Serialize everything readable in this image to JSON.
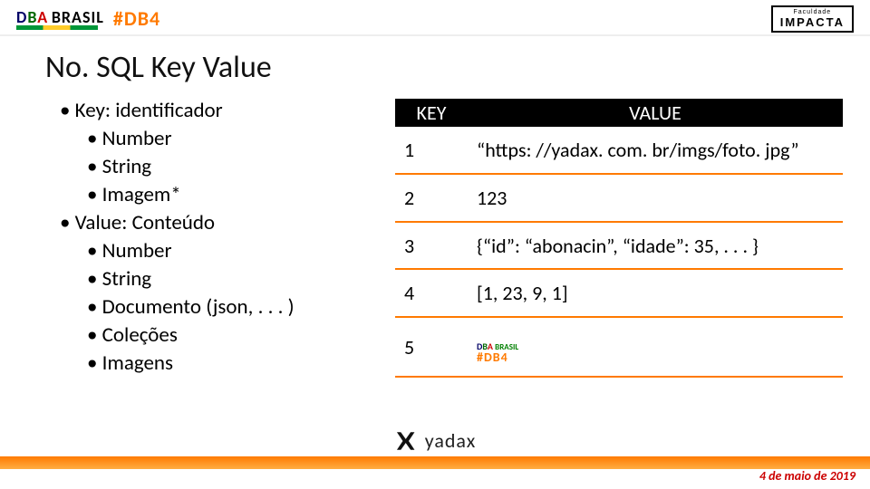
{
  "header": {
    "dba": "DBA",
    "brasil": "BRASIL",
    "db4": "#DB4",
    "impacta_top": "Faculdade",
    "impacta_name": "IMPACTA"
  },
  "title": "No. SQL Key Value",
  "bullets": {
    "l0": "Key: identificador",
    "l1": "Number",
    "l2": "String",
    "l3": "Imagem*",
    "l4": "Value: Conteúdo",
    "l5": "Number",
    "l6": "String",
    "l7": "Documento (json, . . . )",
    "l8": "Coleções",
    "l9": "Imagens"
  },
  "table": {
    "head_key": "KEY",
    "head_val": "VALUE",
    "rows": [
      {
        "k": "1",
        "v": "“https: //yadax. com. br/imgs/foto. jpg”"
      },
      {
        "k": "2",
        "v": "123"
      },
      {
        "k": "3",
        "v": "{“id”: “abonacin”, “idade”: 35, . . . }"
      },
      {
        "k": "4",
        "v": "[1, 23, 9, 1]"
      },
      {
        "k": "5",
        "v": ""
      }
    ],
    "logo_row_index": 4,
    "mini_dba": "DBA",
    "mini_brasil": "BRASIL",
    "mini_db4": "#DB4"
  },
  "footer": {
    "brand": "yadax",
    "date": "4 de maio de 2019"
  }
}
